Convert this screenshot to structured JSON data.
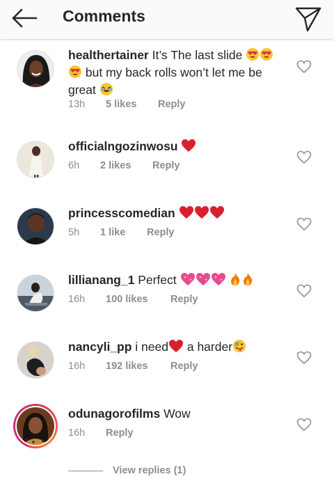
{
  "header": {
    "title": "Comments",
    "back_icon": "arrow-left-icon",
    "send_icon": "paper-plane-icon"
  },
  "comments": [
    {
      "username": "healthertainer",
      "text_a": "It’s The last slide",
      "text_b": "but my back rolls won’t let me be",
      "text_c": "great",
      "time": "13h",
      "likes": "5 likes",
      "reply": "Reply"
    },
    {
      "username": "officialngozinwosu",
      "time": "6h",
      "likes": "2 likes",
      "reply": "Reply"
    },
    {
      "username": "princesscomedian",
      "time": "5h",
      "likes": "1 like",
      "reply": "Reply"
    },
    {
      "username": "lillianang_1",
      "text_a": "Perfect",
      "time": "16h",
      "likes": "100 likes",
      "reply": "Reply"
    },
    {
      "username": "nancyli_pp",
      "text_a": "i need",
      "text_b": "a harder",
      "time": "16h",
      "likes": "192 likes",
      "reply": "Reply"
    },
    {
      "username": "odunagorofilms",
      "text_a": "Wow",
      "time": "16h",
      "reply": "Reply"
    }
  ],
  "view_replies": "View replies (1)",
  "colors": {
    "heart_red": "#d9202f",
    "muted": "#8e8e8e",
    "text": "#262626"
  }
}
